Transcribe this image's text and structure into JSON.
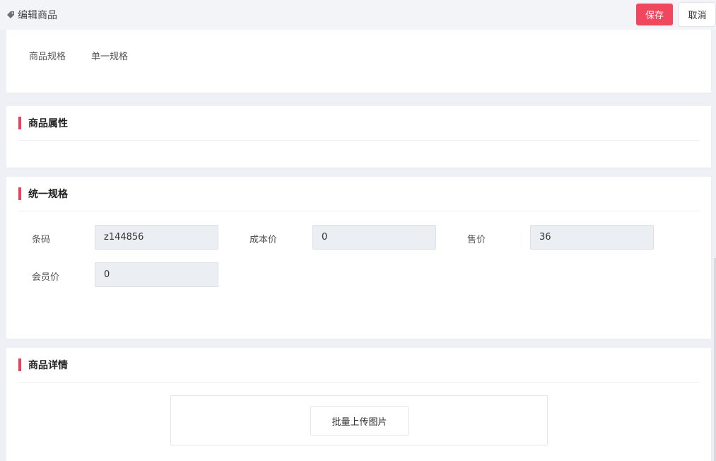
{
  "header": {
    "title": "编辑商品",
    "save_label": "保存",
    "cancel_label": "取消"
  },
  "spec": {
    "label": "商品规格",
    "value": "单一规格"
  },
  "sections": {
    "attributes_title": "商品属性",
    "unified_title": "统一规格",
    "detail_title": "商品详情"
  },
  "fields": {
    "barcode_label": "条码",
    "barcode_value": "z144856",
    "cost_label": "成本价",
    "cost_value": "0",
    "price_label": "售价",
    "price_value": "36",
    "member_label": "会员价",
    "member_value": "0"
  },
  "detail": {
    "upload_label": "批量上传图片"
  },
  "colors": {
    "accent": "#f0475f",
    "background": "#eef0f5"
  }
}
